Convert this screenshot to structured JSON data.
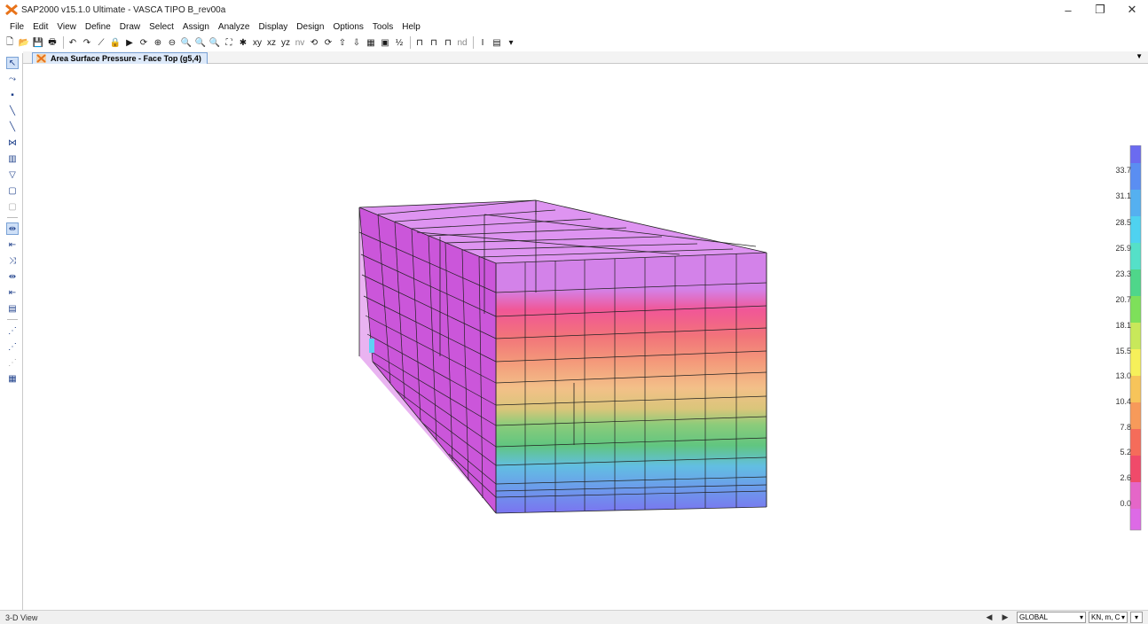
{
  "window": {
    "title": "SAP2000 v15.1.0 Ultimate - VASCA TIPO B_rev00a",
    "minimize": "–",
    "maximize": "❐",
    "close": "✕"
  },
  "menu": [
    "File",
    "Edit",
    "View",
    "Define",
    "Draw",
    "Select",
    "Assign",
    "Analyze",
    "Display",
    "Design",
    "Options",
    "Tools",
    "Help"
  ],
  "toolbar": {
    "view_xy": "xy",
    "view_xz": "xz",
    "view_yz": "yz",
    "view_nv": "nv",
    "nd": "nd"
  },
  "tab": {
    "label": "Area Surface Pressure - Face Top (g5,4)"
  },
  "legend": {
    "values": [
      "33.7",
      "31.1",
      "28.5",
      "25.9",
      "23.3",
      "20.7",
      "18.1",
      "15.5",
      "13.0",
      "10.4",
      "7.8",
      "5.2",
      "2.6",
      "0.0"
    ],
    "colors": [
      "#6b6bf0",
      "#5a8ef2",
      "#55b0f0",
      "#4fd2f0",
      "#55e0c8",
      "#4fd68a",
      "#7ee05a",
      "#c8e85a",
      "#f6f05a",
      "#f7c45a",
      "#f79a5a",
      "#f56c5a",
      "#f04a6a",
      "#e566c8",
      "#dd6ae6"
    ]
  },
  "status": {
    "view": "3-D View",
    "coord_system": "GLOBAL",
    "units": "KN, m, C"
  }
}
